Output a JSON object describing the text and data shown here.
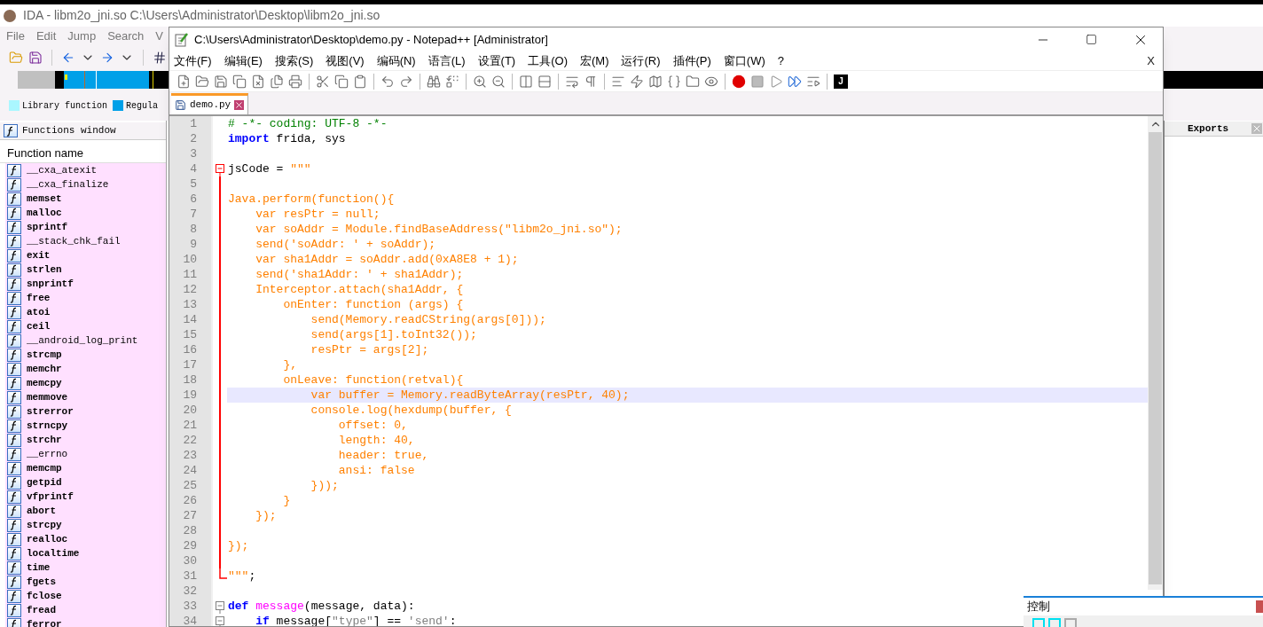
{
  "ida": {
    "title": "IDA - libm2o_jni.so C:\\Users\\Administrator\\Desktop\\libm2o_jni.so",
    "menu": [
      "File",
      "Edit",
      "Jump",
      "Search",
      "V"
    ],
    "legend": [
      {
        "label": "Library function",
        "color": "#aaf7ff"
      },
      {
        "label": "Regula",
        "color": "#00a0e8"
      }
    ],
    "functions_window": {
      "title": "Functions window",
      "column": "Function name",
      "items": [
        {
          "name": "__cxa_atexit",
          "bold": false
        },
        {
          "name": "__cxa_finalize",
          "bold": false
        },
        {
          "name": "memset",
          "bold": true
        },
        {
          "name": "malloc",
          "bold": true
        },
        {
          "name": "sprintf",
          "bold": true
        },
        {
          "name": "__stack_chk_fail",
          "bold": false
        },
        {
          "name": "exit",
          "bold": true
        },
        {
          "name": "strlen",
          "bold": true
        },
        {
          "name": "snprintf",
          "bold": true
        },
        {
          "name": "free",
          "bold": true
        },
        {
          "name": "atoi",
          "bold": true
        },
        {
          "name": "ceil",
          "bold": true
        },
        {
          "name": "__android_log_print",
          "bold": false
        },
        {
          "name": "strcmp",
          "bold": true
        },
        {
          "name": "memchr",
          "bold": true
        },
        {
          "name": "memcpy",
          "bold": true
        },
        {
          "name": "memmove",
          "bold": true
        },
        {
          "name": "strerror",
          "bold": true
        },
        {
          "name": "strncpy",
          "bold": true
        },
        {
          "name": "strchr",
          "bold": true
        },
        {
          "name": "__errno",
          "bold": false
        },
        {
          "name": "memcmp",
          "bold": true
        },
        {
          "name": "getpid",
          "bold": true
        },
        {
          "name": "vfprintf",
          "bold": true
        },
        {
          "name": "abort",
          "bold": true
        },
        {
          "name": "strcpy",
          "bold": true
        },
        {
          "name": "realloc",
          "bold": true
        },
        {
          "name": "localtime",
          "bold": true
        },
        {
          "name": "time",
          "bold": true
        },
        {
          "name": "fgets",
          "bold": true
        },
        {
          "name": "fclose",
          "bold": true
        },
        {
          "name": "fread",
          "bold": true
        },
        {
          "name": "ferror",
          "bold": true
        }
      ]
    },
    "exports_tab": "Exports"
  },
  "notepad": {
    "title": "C:\\Users\\Administrator\\Desktop\\demo.py - Notepad++ [Administrator]",
    "menu": [
      "文件(F)",
      "编辑(E)",
      "搜索(S)",
      "视图(V)",
      "编码(N)",
      "语言(L)",
      "设置(T)",
      "工具(O)",
      "宏(M)",
      "运行(R)",
      "插件(P)",
      "窗口(W)",
      "?"
    ],
    "close_document": "X",
    "run_label": "J",
    "tabs": [
      {
        "label": "demo.py",
        "selected": true
      }
    ],
    "lines": [
      {
        "number": "1",
        "current": false,
        "kind": "plain",
        "segments": [
          {
            "text": "# -*- coding: UTF-8 -*-",
            "kind": "comment"
          }
        ]
      },
      {
        "number": "2",
        "current": false,
        "kind": "plain",
        "segments": [
          {
            "text": "import",
            "kind": "keyword"
          },
          {
            "text": " frida, sys",
            "kind": "plain"
          }
        ]
      },
      {
        "number": "3",
        "current": false,
        "kind": "plain"
      },
      {
        "number": "4",
        "current": false,
        "kind": "fold-start",
        "segments": [
          {
            "text": "jsCode = ",
            "kind": "plain"
          },
          {
            "text": "\"\"\"",
            "kind": "string"
          }
        ]
      },
      {
        "number": "5",
        "current": false,
        "kind": "fold-body"
      },
      {
        "number": "6",
        "current": false,
        "kind": "fold-body",
        "segments": [
          {
            "text": "Java.perform(function(){",
            "kind": "string"
          }
        ]
      },
      {
        "number": "7",
        "current": false,
        "kind": "fold-body",
        "segments": [
          {
            "text": "    var resPtr = null;",
            "kind": "string"
          }
        ]
      },
      {
        "number": "8",
        "current": false,
        "kind": "fold-body",
        "segments": [
          {
            "text": "    var soAddr = Module.findBaseAddress(\"libm2o_jni.so\");",
            "kind": "string"
          }
        ]
      },
      {
        "number": "9",
        "current": false,
        "kind": "fold-body",
        "segments": [
          {
            "text": "    send('soAddr: ' + soAddr);",
            "kind": "string"
          }
        ]
      },
      {
        "number": "10",
        "current": false,
        "kind": "fold-body",
        "segments": [
          {
            "text": "    var sha1Addr = soAddr.add(0xA8E8 + 1);",
            "kind": "string"
          }
        ]
      },
      {
        "number": "11",
        "current": false,
        "kind": "fold-body",
        "segments": [
          {
            "text": "    send('sha1Addr: ' + sha1Addr);",
            "kind": "string"
          }
        ]
      },
      {
        "number": "12",
        "current": false,
        "kind": "fold-body",
        "segments": [
          {
            "text": "    Interceptor.attach(sha1Addr, {",
            "kind": "string"
          }
        ]
      },
      {
        "number": "13",
        "current": false,
        "kind": "fold-body",
        "segments": [
          {
            "text": "        onEnter: function (args) {",
            "kind": "string"
          }
        ]
      },
      {
        "number": "14",
        "current": false,
        "kind": "fold-body",
        "segments": [
          {
            "text": "            send(Memory.readCString(args[0]));",
            "kind": "string"
          }
        ]
      },
      {
        "number": "15",
        "current": false,
        "kind": "fold-body",
        "segments": [
          {
            "text": "            send(args[1].toInt32());",
            "kind": "string"
          }
        ]
      },
      {
        "number": "16",
        "current": false,
        "kind": "fold-body",
        "segments": [
          {
            "text": "            resPtr = args[2];",
            "kind": "string"
          }
        ]
      },
      {
        "number": "17",
        "current": false,
        "kind": "fold-body",
        "segments": [
          {
            "text": "        },",
            "kind": "string"
          }
        ]
      },
      {
        "number": "18",
        "current": false,
        "kind": "fold-body",
        "segments": [
          {
            "text": "        onLeave: function(retval){",
            "kind": "string"
          }
        ]
      },
      {
        "number": "19",
        "current": true,
        "kind": "fold-body",
        "segments": [
          {
            "text": "            var buffer = Memory.readByteArray(resPtr, 40);",
            "kind": "string"
          }
        ]
      },
      {
        "number": "20",
        "current": false,
        "kind": "fold-body",
        "segments": [
          {
            "text": "            console.log(hexdump(buffer, {",
            "kind": "string"
          }
        ]
      },
      {
        "number": "21",
        "current": false,
        "kind": "fold-body",
        "segments": [
          {
            "text": "                offset: 0,",
            "kind": "string"
          }
        ]
      },
      {
        "number": "22",
        "current": false,
        "kind": "fold-body",
        "segments": [
          {
            "text": "                length: 40,",
            "kind": "string"
          }
        ]
      },
      {
        "number": "23",
        "current": false,
        "kind": "fold-body",
        "segments": [
          {
            "text": "                header: true,",
            "kind": "string"
          }
        ]
      },
      {
        "number": "24",
        "current": false,
        "kind": "fold-body",
        "segments": [
          {
            "text": "                ansi: false",
            "kind": "string"
          }
        ]
      },
      {
        "number": "25",
        "current": false,
        "kind": "fold-body",
        "segments": [
          {
            "text": "            }));",
            "kind": "string"
          }
        ]
      },
      {
        "number": "26",
        "current": false,
        "kind": "fold-body",
        "segments": [
          {
            "text": "        }",
            "kind": "string"
          }
        ]
      },
      {
        "number": "27",
        "current": false,
        "kind": "fold-body",
        "segments": [
          {
            "text": "    });",
            "kind": "string"
          }
        ]
      },
      {
        "number": "28",
        "current": false,
        "kind": "fold-body"
      },
      {
        "number": "29",
        "current": false,
        "kind": "fold-body",
        "segments": [
          {
            "text": "});",
            "kind": "string"
          }
        ]
      },
      {
        "number": "30",
        "current": false,
        "kind": "fold-body"
      },
      {
        "number": "31",
        "current": false,
        "kind": "fold-end",
        "segments": [
          {
            "text": "\"\"\"",
            "kind": "string"
          },
          {
            "text": ";",
            "kind": "plain"
          }
        ]
      },
      {
        "number": "32",
        "current": false,
        "kind": "plain"
      },
      {
        "number": "33",
        "current": false,
        "kind": "box",
        "segments": [
          {
            "text": "def",
            "kind": "keyword"
          },
          {
            "text": " message",
            "kind": "function"
          },
          {
            "text": "(message, data):",
            "kind": "plain"
          }
        ]
      },
      {
        "number": "34",
        "current": false,
        "kind": "box",
        "segments": [
          {
            "text": "    if",
            "kind": "keyword"
          },
          {
            "text": " message[",
            "kind": "plain"
          },
          {
            "text": "\"type\"",
            "kind": "pystring"
          },
          {
            "text": "] == ",
            "kind": "plain"
          },
          {
            "text": "'send'",
            "kind": "pystring"
          },
          {
            "text": ":",
            "kind": "plain"
          }
        ]
      }
    ]
  },
  "control_panel": {
    "title": "控制"
  }
}
